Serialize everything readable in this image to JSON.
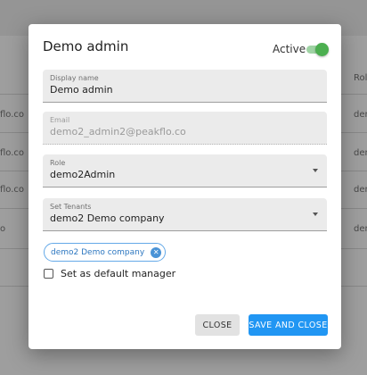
{
  "background": {
    "header_cell": "Rol",
    "rows": [
      {
        "left": "flo.co",
        "right": "dem"
      },
      {
        "left": "flo.co",
        "right": "dem"
      },
      {
        "left": "flo.co",
        "right": "dem"
      },
      {
        "left": "o",
        "right": "dem"
      }
    ]
  },
  "dialog": {
    "title": "Demo admin",
    "active_label": "Active",
    "active": true,
    "fields": {
      "display_name": {
        "label": "Display name",
        "value": "Demo admin"
      },
      "email": {
        "label": "Email",
        "value": "demo2_admin2@peakflo.co",
        "disabled": true
      },
      "role": {
        "label": "Role",
        "value": "demo2Admin"
      },
      "tenants": {
        "label": "Set Tenants",
        "value": "demo2 Demo company"
      }
    },
    "chip_label": "demo2 Demo company",
    "default_manager_label": "Set as default manager",
    "default_manager_checked": false,
    "buttons": {
      "close": "CLOSE",
      "save": "SAVE AND CLOSE"
    },
    "colors": {
      "accent": "#2196f3",
      "switch_on": "#4caf50"
    }
  }
}
